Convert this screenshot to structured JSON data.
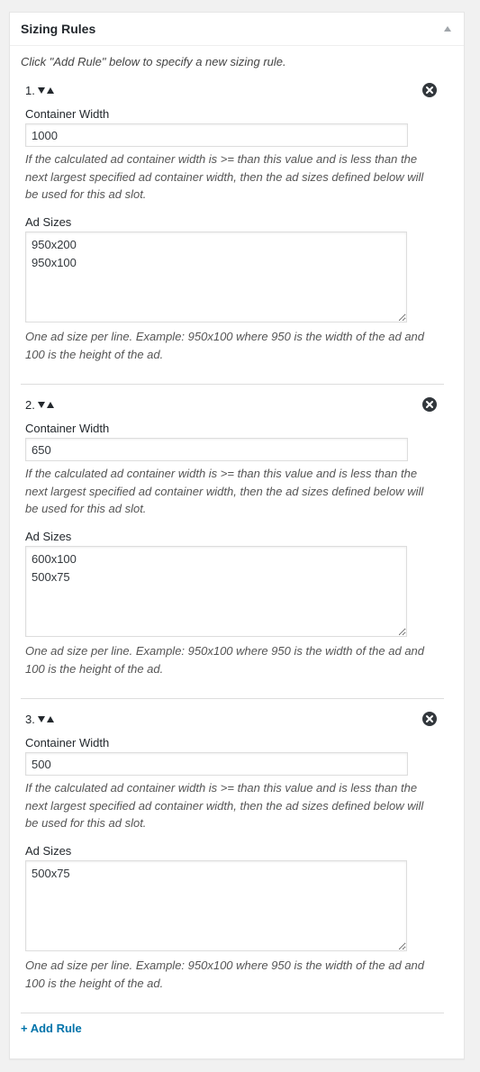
{
  "panel": {
    "title": "Sizing Rules",
    "intro": "Click \"Add Rule\" below to specify a new sizing rule.",
    "add_rule_label": "+ Add Rule"
  },
  "rules": [
    {
      "number": "1.",
      "container_width_label": "Container Width",
      "container_width_value": "1000",
      "width_description": "If the calculated ad container width is >= than this value and is less than the next largest specified ad container width, then the ad sizes defined below will be used for this ad slot.",
      "ad_sizes_label": "Ad Sizes",
      "ad_sizes_value": "950x200\n950x100",
      "sizes_description": "One ad size per line. Example: 950x100 where 950 is the width of the ad and 100 is the height of the ad."
    },
    {
      "number": "2.",
      "container_width_label": "Container Width",
      "container_width_value": "650",
      "width_description": "If the calculated ad container width is >= than this value and is less than the next largest specified ad container width, then the ad sizes defined below will be used for this ad slot.",
      "ad_sizes_label": "Ad Sizes",
      "ad_sizes_value": "600x100\n500x75",
      "sizes_description": "One ad size per line. Example: 950x100 where 950 is the width of the ad and 100 is the height of the ad."
    },
    {
      "number": "3.",
      "container_width_label": "Container Width",
      "container_width_value": "500",
      "width_description": "If the calculated ad container width is >= than this value and is less than the next largest specified ad container width, then the ad sizes defined below will be used for this ad slot.",
      "ad_sizes_label": "Ad Sizes",
      "ad_sizes_value": "500x75",
      "sizes_description": "One ad size per line. Example: 950x100 where 950 is the width of the ad and 100 is the height of the ad."
    }
  ],
  "icons": {
    "toggle": "triangle-up-icon",
    "move": "reorder-arrows-icon",
    "remove": "remove-circle-x-icon"
  },
  "colors": {
    "link": "#0073aa",
    "remove_icon": "#32373c",
    "border": "#dddddd"
  }
}
